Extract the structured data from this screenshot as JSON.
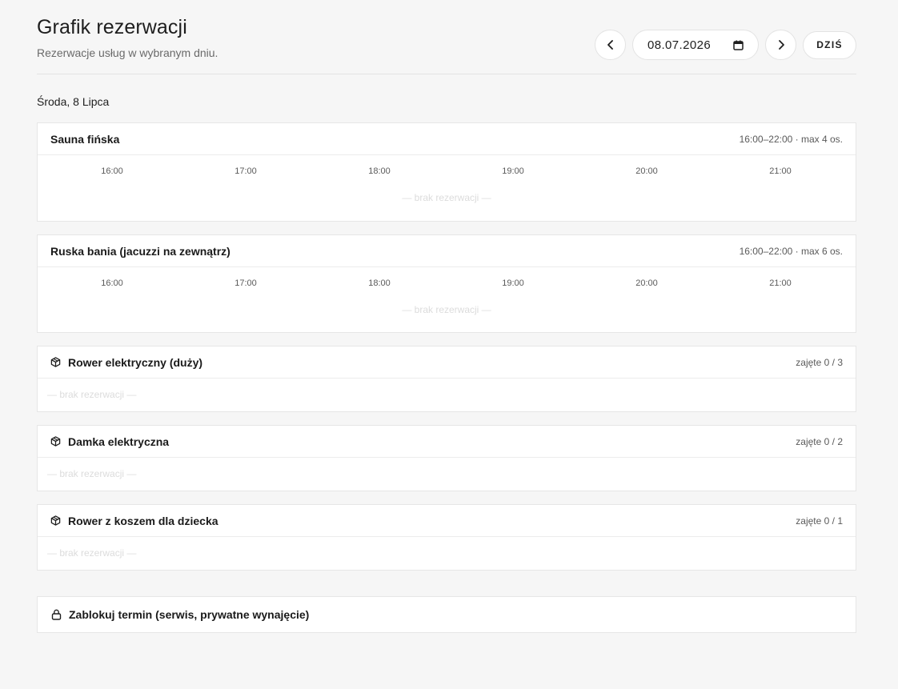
{
  "header": {
    "title": "Grafik rezerwacji",
    "subtitle": "Rezerwacje usług w wybranym dniu.",
    "date_value": "08.07.2026",
    "today_label": "DZIŚ"
  },
  "day_label": "Środa, 8 Lipca",
  "hours": [
    "16:00",
    "17:00",
    "18:00",
    "19:00",
    "20:00",
    "21:00"
  ],
  "empty_text": "— brak rezerwacji —",
  "services": [
    {
      "title": "Sauna fińska",
      "meta": "16:00–22:00 · max 4 os."
    },
    {
      "title": "Ruska bania (jacuzzi na zewnątrz)",
      "meta": "16:00–22:00 · max 6 os."
    }
  ],
  "equipment": [
    {
      "title": "Rower elektryczny (duży)",
      "meta": "zajęte 0 / 3"
    },
    {
      "title": "Damka elektryczna",
      "meta": "zajęte 0 / 2"
    },
    {
      "title": "Rower z koszem dla dziecka",
      "meta": "zajęte 0 / 1"
    }
  ],
  "block_label": "Zablokuj termin (serwis, prywatne wynajęcie)",
  "icons": {
    "prev": "chevron-left-icon",
    "next": "chevron-right-icon",
    "calendar": "calendar-icon",
    "equipment": "package-icon",
    "block": "lock-icon"
  }
}
